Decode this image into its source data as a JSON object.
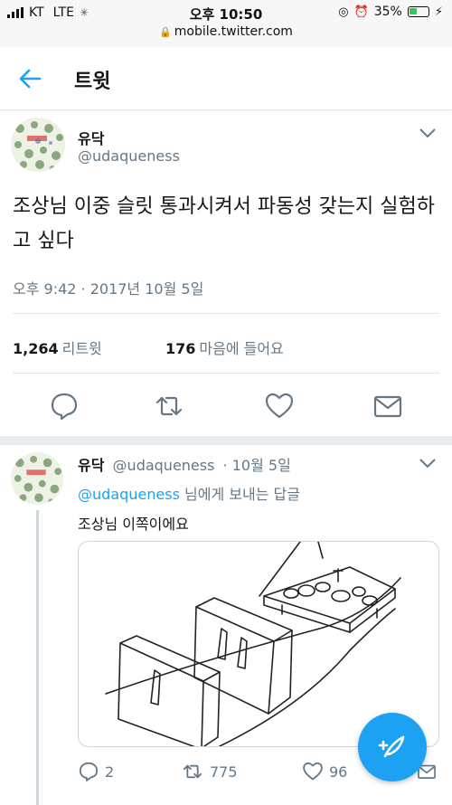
{
  "status_bar": {
    "carrier": "KT",
    "network": "LTE",
    "time": "오후 10:50",
    "battery": "35%",
    "url": "mobile.twitter.com"
  },
  "header": {
    "title": "트윗"
  },
  "tweet": {
    "name": "유닥",
    "handle": "@udaqueness",
    "text": "조상님 이중 슬릿 통과시켜서 파동성 갖는지 실험하고 싶다",
    "timestamp": "오후 9:42 · 2017년 10월 5일",
    "retweet_count": "1,264",
    "retweet_label": "리트윗",
    "like_count": "176",
    "like_label": "마음에 들어요"
  },
  "reply": {
    "name": "유닥",
    "handle": "@udaqueness",
    "date": "· 10월 5일",
    "replying_to_handle": "@udaqueness",
    "replying_to_suffix": "님에게 보내는 답글",
    "text": "조상님 이쪽이에요",
    "reply_count": "2",
    "retweet_count": "775",
    "like_count": "96"
  },
  "colors": {
    "accent": "#1da1f2",
    "secondary_text": "#657786",
    "border": "#e1e8ed"
  }
}
